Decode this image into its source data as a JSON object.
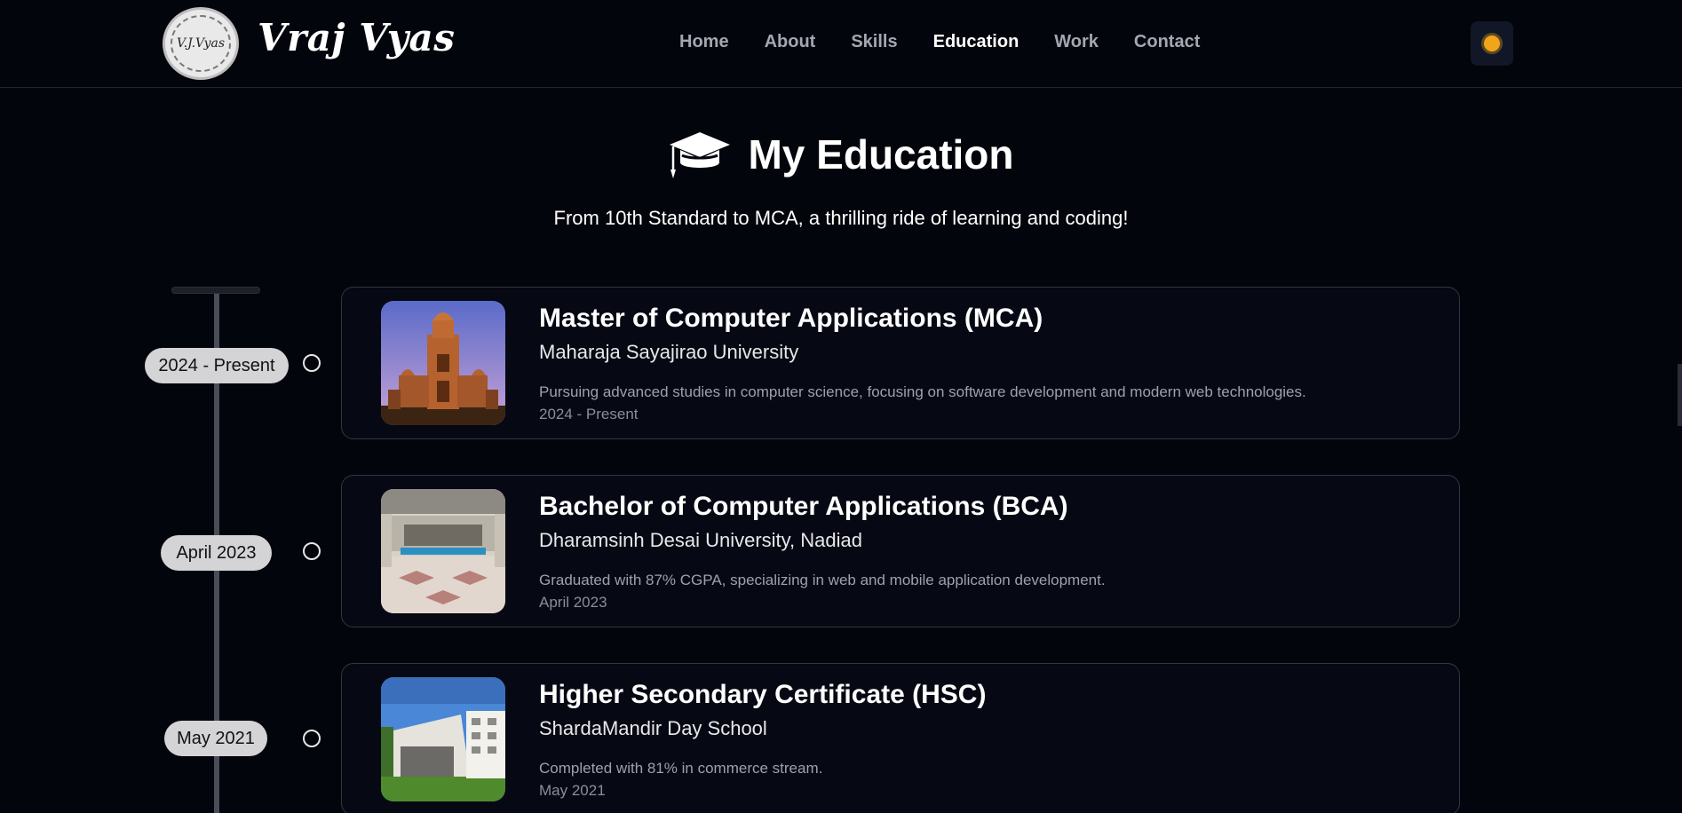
{
  "brand": {
    "logo_text": "V.J.Vyas",
    "name": "Vraj Vyas"
  },
  "nav": {
    "items": [
      {
        "label": "Home",
        "active": false
      },
      {
        "label": "About",
        "active": false
      },
      {
        "label": "Skills",
        "active": false
      },
      {
        "label": "Education",
        "active": true
      },
      {
        "label": "Work",
        "active": false
      },
      {
        "label": "Contact",
        "active": false
      }
    ],
    "theme_toggle_icon": "sun-icon"
  },
  "section": {
    "icon": "graduation-cap-icon",
    "title": "My Education",
    "subtitle": "From 10th Standard to MCA, a thrilling ride of learning and coding!"
  },
  "education": [
    {
      "date_label": "2024 - Present",
      "degree": "Master of Computer Applications (MCA)",
      "institution": "Maharaja Sayajirao University",
      "description": "Pursuing advanced studies in computer science, focusing on software development and modern web technologies.",
      "period": "2024 - Present"
    },
    {
      "date_label": "April 2023",
      "degree": "Bachelor of Computer Applications (BCA)",
      "institution": "Dharamsinh Desai University, Nadiad",
      "description": "Graduated with 87% CGPA, specializing in web and mobile application development.",
      "period": "April 2023"
    },
    {
      "date_label": "May 2021",
      "degree": "Higher Secondary Certificate (HSC)",
      "institution": "ShardaMandir Day School",
      "description": "Completed with 81% in commerce stream.",
      "period": "May 2021"
    }
  ],
  "colors": {
    "background": "#03050c",
    "accent_sun": "#f2a51a",
    "pill": "#d4d4d6"
  }
}
